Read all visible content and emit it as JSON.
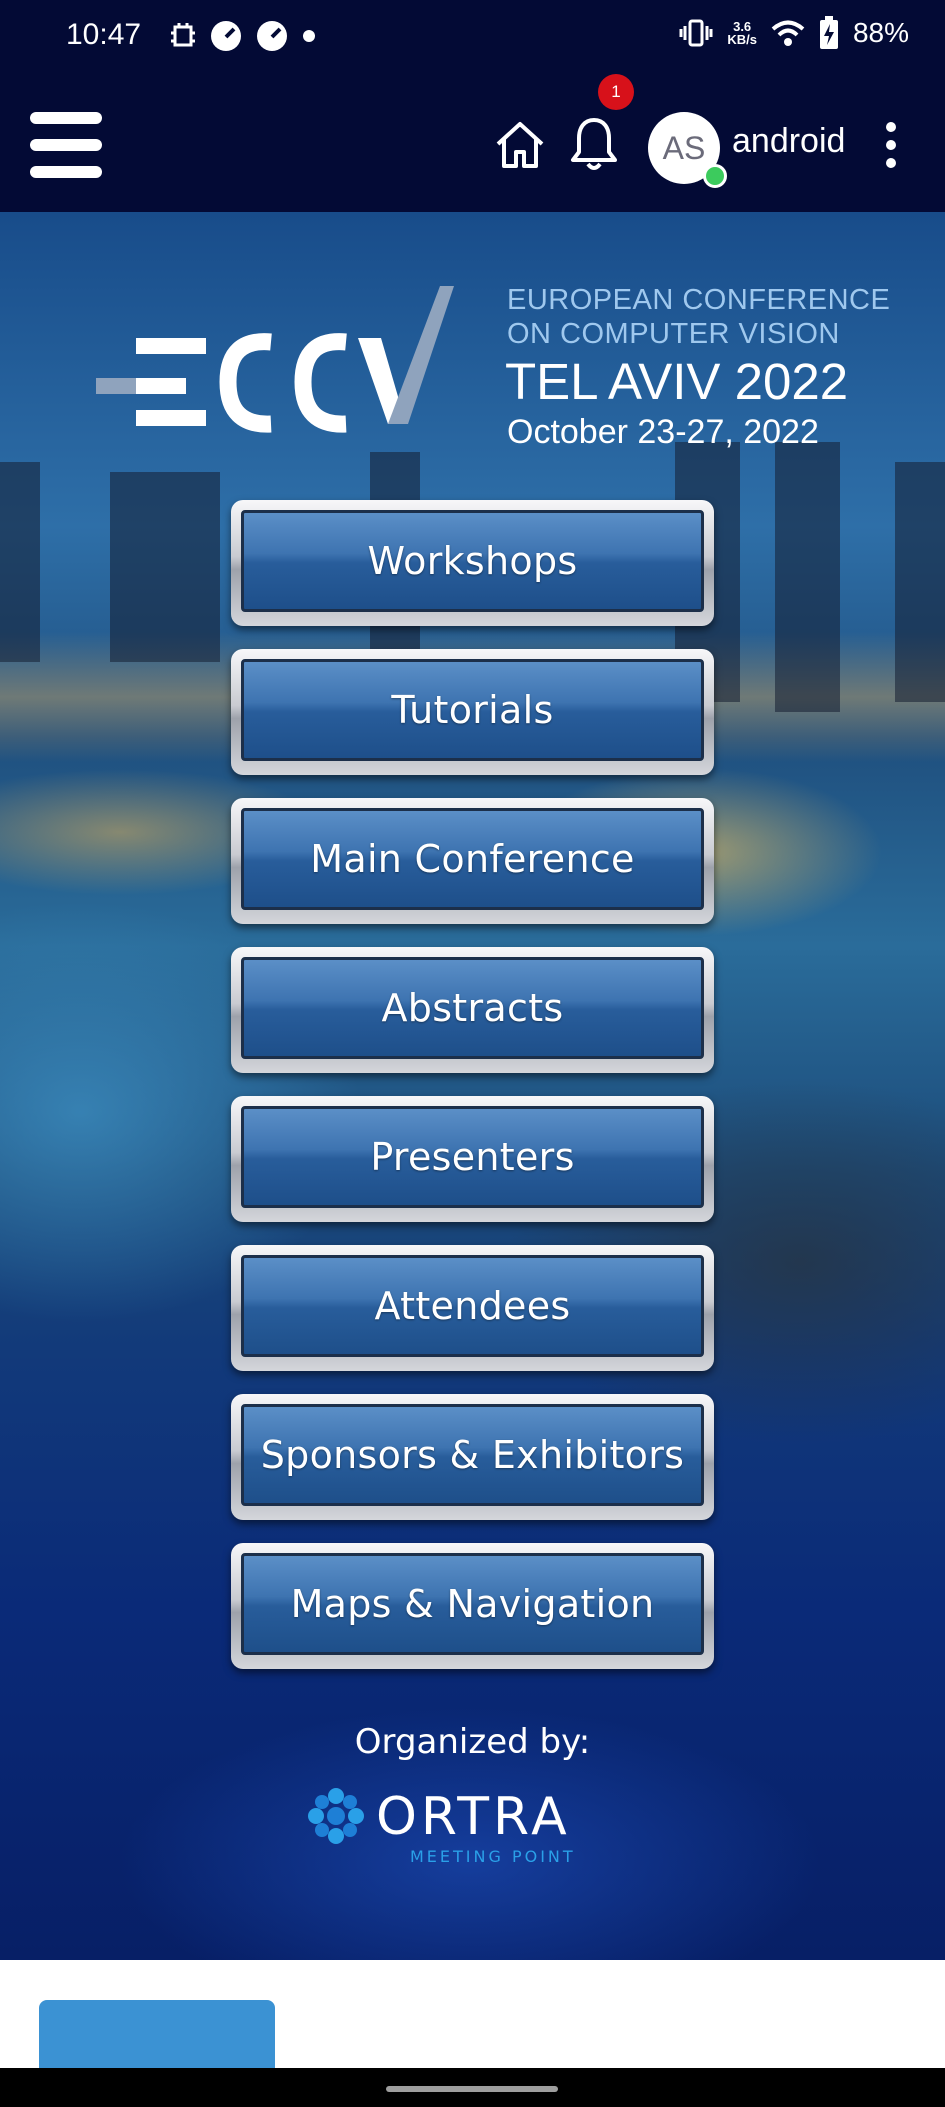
{
  "status_bar": {
    "time": "10:47",
    "net_speed_value": "3.6",
    "net_speed_unit": "KB/s",
    "battery": "88%",
    "icons_left": [
      "debug-icon",
      "speedometer-icon",
      "speedometer-icon",
      "dot-icon"
    ],
    "icons_right": [
      "vibrate-icon",
      "wifi-icon",
      "battery-charging-icon"
    ]
  },
  "app_bar": {
    "notification_count": "1",
    "avatar_initials": "AS",
    "username": "android",
    "background_color": "#030a35"
  },
  "hero": {
    "conference_line1": "EUROPEAN CONFERENCE",
    "conference_line2": "ON COMPUTER VISION",
    "city_year": "TEL AVIV 2022",
    "dates": "October 23-27, 2022",
    "logo_text": "ECCV"
  },
  "menu": {
    "items": [
      {
        "label": "Workshops"
      },
      {
        "label": "Tutorials"
      },
      {
        "label": "Main Conference"
      },
      {
        "label": "Abstracts"
      },
      {
        "label": "Presenters"
      },
      {
        "label": "Attendees"
      },
      {
        "label": "Sponsors & Exhibitors"
      },
      {
        "label": "Maps & Navigation"
      }
    ]
  },
  "organizer": {
    "label": "Organized by:",
    "logo_name": "ORTRA",
    "logo_tagline": "MEETING POINT"
  },
  "colors": {
    "accent": "#3b92d3",
    "badge": "#d7111a",
    "online": "#3ccb5d"
  }
}
